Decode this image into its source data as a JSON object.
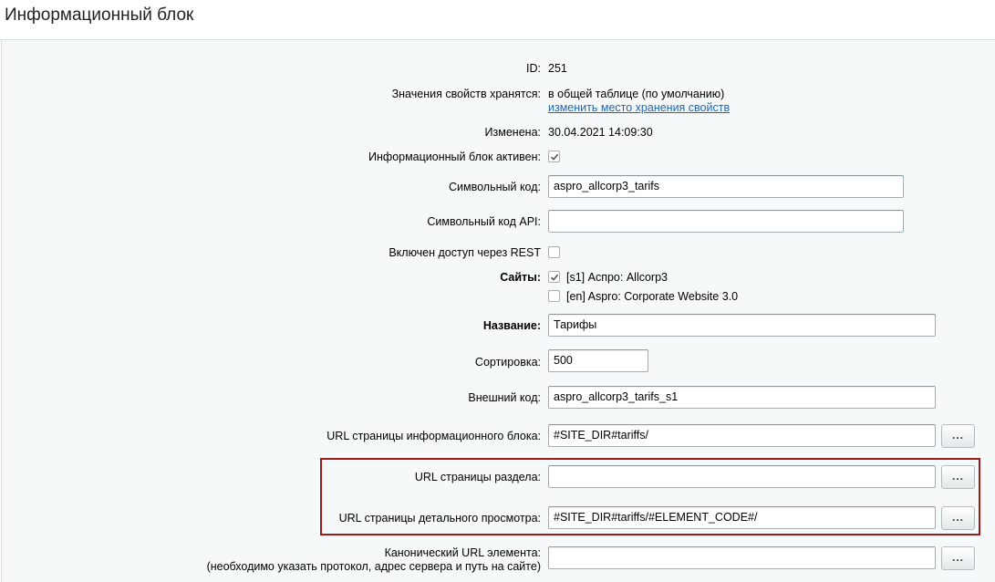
{
  "header": {
    "title": "Информационный блок"
  },
  "fields": {
    "id": {
      "label": "ID:",
      "value": "251"
    },
    "storage": {
      "label": "Значения свойств хранятся:",
      "value": "в общей таблице (по умолчанию)",
      "link": "изменить место хранения свойств"
    },
    "modified": {
      "label": "Изменена:",
      "value": "30.04.2021 14:09:30"
    },
    "active": {
      "label": "Информационный блок активен:",
      "checked": true
    },
    "code": {
      "label": "Символьный код:",
      "value": "aspro_allcorp3_tarifs"
    },
    "api_code": {
      "label": "Символьный код API:",
      "value": ""
    },
    "rest": {
      "label": "Включен доступ через REST",
      "checked": false
    },
    "sites": {
      "label": "Сайты:",
      "items": [
        {
          "label": "[s1] Аспро: Allcorp3",
          "checked": true
        },
        {
          "label": "[en] Aspro: Corporate Website 3.0",
          "checked": false
        }
      ]
    },
    "name": {
      "label": "Название:",
      "value": "Тарифы"
    },
    "sort": {
      "label": "Сортировка:",
      "value": "500"
    },
    "external_code": {
      "label": "Внешний код:",
      "value": "aspro_allcorp3_tarifs_s1"
    },
    "list_url": {
      "label": "URL страницы информационного блока:",
      "value": "#SITE_DIR#tariffs/"
    },
    "section_url": {
      "label": "URL страницы раздела:",
      "value": ""
    },
    "detail_url": {
      "label": "URL страницы детального просмотра:",
      "value": "#SITE_DIR#tariffs/#ELEMENT_CODE#/"
    },
    "canonical_url": {
      "label": "Канонический URL элемента:",
      "hint": "(необходимо указать протокол, адрес сервера и путь на сайте)",
      "value": ""
    }
  },
  "buttons": {
    "dots": "..."
  },
  "colors": {
    "highlight_border": "#9e1a1a",
    "link": "#2067b0",
    "panel_bg": "#f5f9f9"
  }
}
